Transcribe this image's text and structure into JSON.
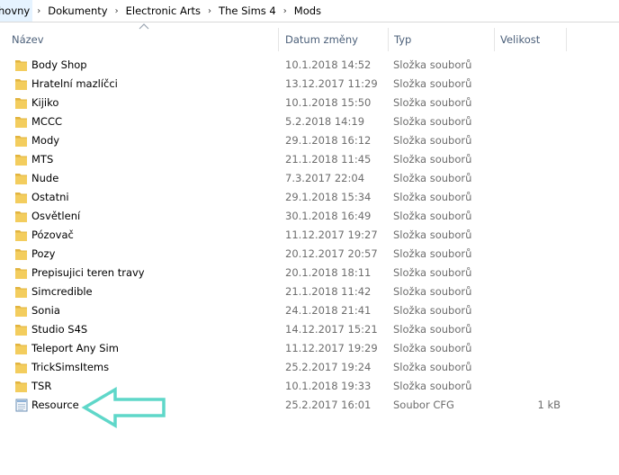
{
  "breadcrumb": {
    "items": [
      "hovny",
      "Dokumenty",
      "Electronic Arts",
      "The Sims 4",
      "Mods"
    ]
  },
  "columns": {
    "name": "Název",
    "date": "Datum změny",
    "type": "Typ",
    "size": "Velikost"
  },
  "files": [
    {
      "name": "Body Shop",
      "date": "10.1.2018 14:52",
      "type": "Složka souborů",
      "size": "",
      "icon": "folder-icon"
    },
    {
      "name": "Hratelní mazlíčci",
      "date": "13.12.2017 11:29",
      "type": "Složka souborů",
      "size": "",
      "icon": "folder-icon"
    },
    {
      "name": "Kijiko",
      "date": "10.1.2018 15:50",
      "type": "Složka souborů",
      "size": "",
      "icon": "folder-icon"
    },
    {
      "name": "MCCC",
      "date": "5.2.2018 14:19",
      "type": "Složka souborů",
      "size": "",
      "icon": "folder-icon"
    },
    {
      "name": "Mody",
      "date": "29.1.2018 16:12",
      "type": "Složka souborů",
      "size": "",
      "icon": "folder-icon"
    },
    {
      "name": "MTS",
      "date": "21.1.2018 11:45",
      "type": "Složka souborů",
      "size": "",
      "icon": "folder-icon"
    },
    {
      "name": "Nude",
      "date": "7.3.2017 22:04",
      "type": "Složka souborů",
      "size": "",
      "icon": "folder-icon"
    },
    {
      "name": "Ostatni",
      "date": "29.1.2018 15:34",
      "type": "Složka souborů",
      "size": "",
      "icon": "folder-icon"
    },
    {
      "name": "Osvětlení",
      "date": "30.1.2018 16:49",
      "type": "Složka souborů",
      "size": "",
      "icon": "folder-icon"
    },
    {
      "name": "Pózovač",
      "date": "11.12.2017 19:27",
      "type": "Složka souborů",
      "size": "",
      "icon": "folder-icon"
    },
    {
      "name": "Pozy",
      "date": "20.12.2017 20:57",
      "type": "Složka souborů",
      "size": "",
      "icon": "folder-icon"
    },
    {
      "name": "Prepisujici teren travy",
      "date": "20.1.2018 18:11",
      "type": "Složka souborů",
      "size": "",
      "icon": "folder-icon"
    },
    {
      "name": "Simcredible",
      "date": "21.1.2018 11:42",
      "type": "Složka souborů",
      "size": "",
      "icon": "folder-icon"
    },
    {
      "name": "Sonia",
      "date": "24.1.2018 21:41",
      "type": "Složka souborů",
      "size": "",
      "icon": "folder-icon"
    },
    {
      "name": "Studio S4S",
      "date": "14.12.2017 15:21",
      "type": "Složka souborů",
      "size": "",
      "icon": "folder-icon"
    },
    {
      "name": "Teleport Any Sim",
      "date": "11.12.2017 19:29",
      "type": "Složka souborů",
      "size": "",
      "icon": "folder-icon"
    },
    {
      "name": "TrickSimsItems",
      "date": "25.2.2017 19:24",
      "type": "Složka souborů",
      "size": "",
      "icon": "folder-icon"
    },
    {
      "name": "TSR",
      "date": "10.1.2018 19:33",
      "type": "Složka souborů",
      "size": "",
      "icon": "folder-icon"
    },
    {
      "name": "Resource",
      "date": "25.2.2017 16:01",
      "type": "Soubor CFG",
      "size": "1 kB",
      "icon": "cfg-file-icon"
    }
  ],
  "colors": {
    "folder": "#f3cd5e",
    "folder_dark": "#e2b43f",
    "annotation": "#5fd7c9",
    "header_text": "#4c607a"
  }
}
